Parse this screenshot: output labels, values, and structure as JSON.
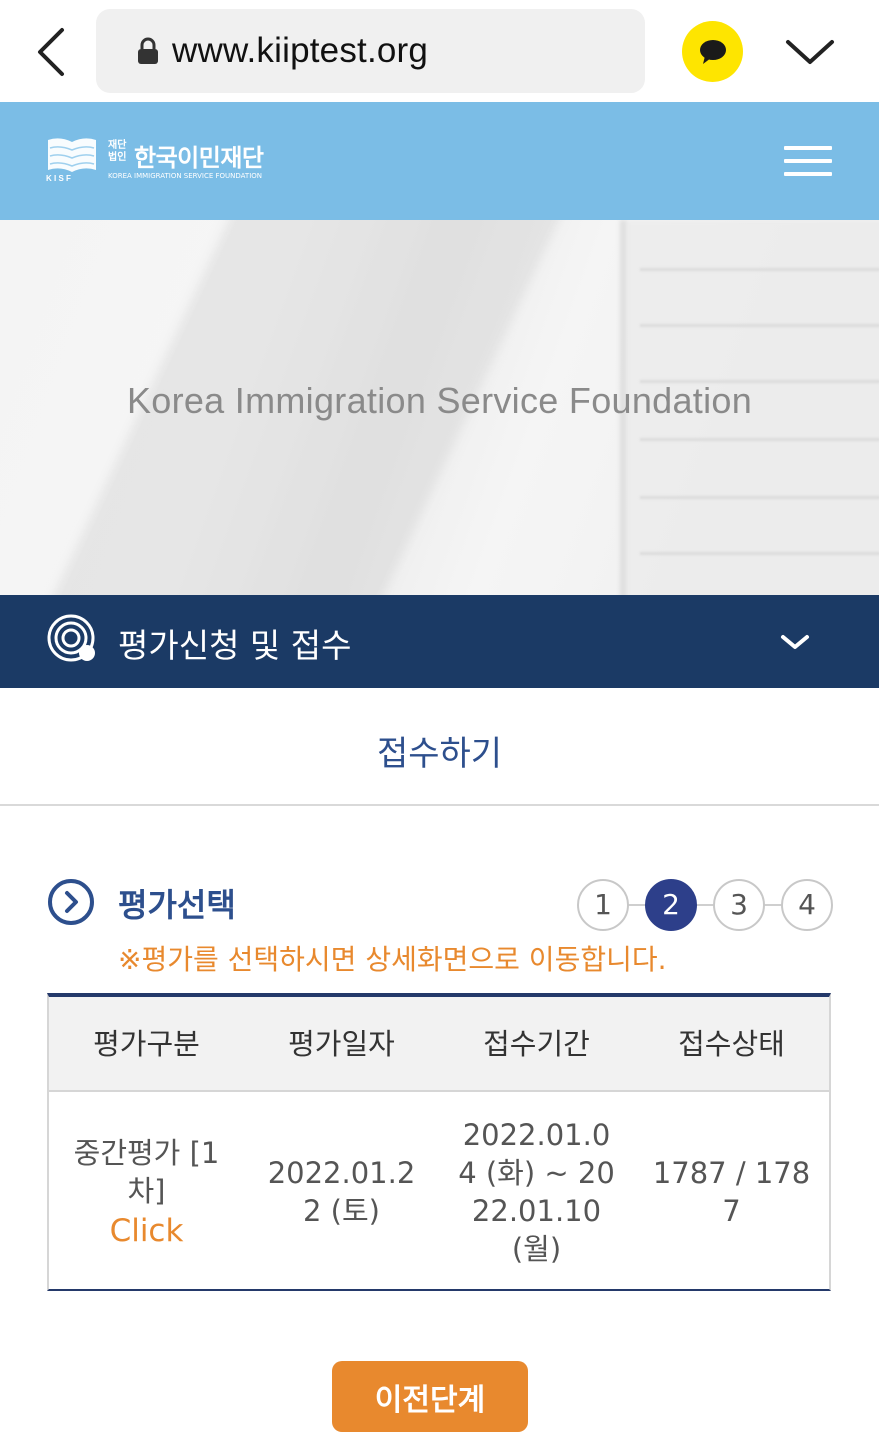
{
  "browser": {
    "url": "www.kiiptest.org"
  },
  "header": {
    "logo_small_line1": "재단",
    "logo_small_line2": "법인",
    "logo_name": "한국이민재단",
    "logo_sub": "KOREA IMMIGRATION SERVICE FOUNDATION",
    "logo_letters": "K I S F"
  },
  "hero": {
    "title": "Korea Immigration Service Foundation"
  },
  "nav": {
    "label": "평가신청 및 접수"
  },
  "page": {
    "subtitle": "접수하기",
    "section_title": "평가선택",
    "notice": "※평가를 선택하시면 상세화면으로 이동합니다.",
    "steps": [
      "1",
      "2",
      "3",
      "4"
    ],
    "active_step": 2
  },
  "table": {
    "headers": [
      "평가구분",
      "평가일자",
      "접수기간",
      "접수상태"
    ],
    "rows": [
      {
        "type": "중간평가 [1차]",
        "click": "Click",
        "date": "2022.01.22 (토)",
        "period": "2022.01.04 (화) ~ 2022.01.10 (월)",
        "status": "1787 / 1787"
      }
    ]
  },
  "buttons": {
    "prev": "이전단계"
  },
  "colors": {
    "header_bg": "#7BBDE6",
    "nav_bg": "#1B3A65",
    "accent_orange": "#E8892E",
    "step_active": "#2d3f8a",
    "title_blue": "#2d4f8d"
  }
}
